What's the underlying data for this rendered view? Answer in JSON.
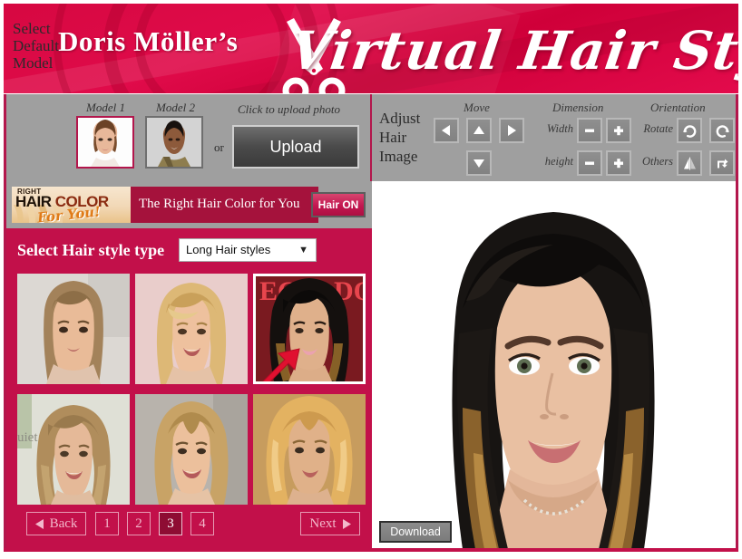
{
  "header": {
    "brand": "Doris Möller’s",
    "title": "Virtual Hair Styler",
    "scissors_icon": "scissors-icon"
  },
  "model_panel": {
    "section_label": "Select Default Model",
    "model1_caption": "Model 1",
    "model2_caption": "Model 2",
    "or_text": "or",
    "upload_caption": "Click to upload photo",
    "upload_button": "Upload",
    "selected_model": "Model 1"
  },
  "adjust_panel": {
    "section_label": "Adjust Hair Image",
    "groups": {
      "move": "Move",
      "dimension": "Dimension",
      "orientation": "Orientation"
    },
    "labels": {
      "width": "Width",
      "height": "height",
      "rotate": "Rotate",
      "others": "Others"
    },
    "buttons": {
      "move_left": "move-left-icon",
      "move_up": "move-up-icon",
      "move_right": "move-right-icon",
      "move_down": "move-down-icon",
      "width_minus": "−",
      "width_plus": "+",
      "height_minus": "−",
      "height_plus": "+",
      "rotate_cw": "rotate-cw-icon",
      "rotate_ccw": "rotate-ccw-icon",
      "flip_horizontal": "flip-horizontal-icon",
      "flip_vertical": "flip-vertical-icon"
    }
  },
  "ad_banner": {
    "logo_line1": "RIGHT",
    "logo_line2a": "HAIR ",
    "logo_line2b": "COLOR",
    "logo_line3": "For You!",
    "text": "The Right Hair Color for You",
    "hair_toggle": "Hair ON"
  },
  "style_selector": {
    "label": "Select Hair style type",
    "selected_option": "Long Hair styles",
    "caret_icon": "chevron-down-icon",
    "options": [
      "Long Hair styles"
    ]
  },
  "thumbnails": [
    {
      "id": 1,
      "selected": false,
      "hair": "straight-light-brown",
      "bg": "#d9d5d0"
    },
    {
      "id": 2,
      "selected": false,
      "hair": "layered-blonde",
      "bg": "#e7c9c9"
    },
    {
      "id": 3,
      "selected": true,
      "hair": "long-dark-ombre",
      "bg": "#8c1a22"
    },
    {
      "id": 4,
      "selected": false,
      "hair": "wavy-dark-blonde",
      "bg": "#dfe0d4"
    },
    {
      "id": 5,
      "selected": false,
      "hair": "long-blonde-center-part",
      "bg": "#b9b4ad"
    },
    {
      "id": 6,
      "selected": false,
      "hair": "golden-wavy",
      "bg": "#c8a064"
    }
  ],
  "cursor": {
    "icon": "red-arrow-cursor",
    "points_at_thumbnail": 3
  },
  "pagination": {
    "back_label": "Back",
    "back_icon": "triangle-left-icon",
    "pages": [
      "1",
      "2",
      "3",
      "4"
    ],
    "active_page": "3",
    "next_label": "Next",
    "next_icon": "triangle-right-icon"
  },
  "preview": {
    "download_button": "Download",
    "model_description": "model-with-long-dark-ombre-hair"
  },
  "colors": {
    "brand_pink": "#c2104a",
    "header_red": "#d60841",
    "toolbar_gray": "#9f9f9f",
    "ad_red": "#a5123c",
    "active_page_bg": "#8e0c33",
    "cursor_red": "#e01030"
  }
}
